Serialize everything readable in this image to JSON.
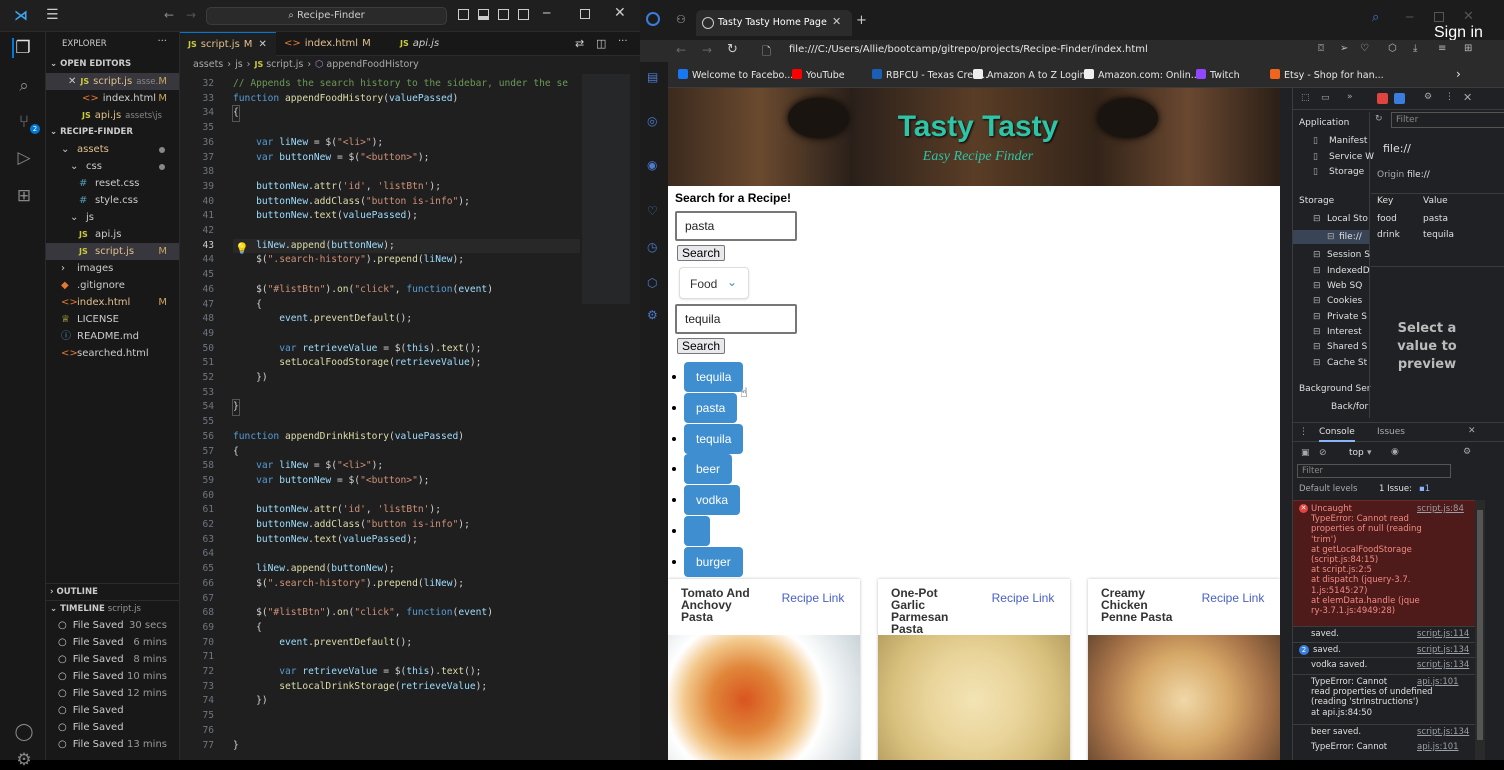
{
  "vscode": {
    "title": "Recipe-Finder",
    "explorer_label": "EXPLORER",
    "open_editors_label": "OPEN EDITORS",
    "open_editors": [
      {
        "name": "script.js",
        "desc": "asse...",
        "mark": "M",
        "type": "js"
      },
      {
        "name": "index.html",
        "desc": "",
        "mark": "M",
        "type": "html"
      },
      {
        "name": "api.js",
        "desc": "assets\\js",
        "mark": "",
        "type": "js"
      }
    ],
    "project_label": "RECIPE-FINDER",
    "tree": [
      {
        "name": "assets",
        "type": "folder",
        "indent": 1
      },
      {
        "name": "css",
        "type": "folder",
        "indent": 2
      },
      {
        "name": "reset.css",
        "type": "css",
        "indent": 3
      },
      {
        "name": "style.css",
        "type": "css",
        "indent": 3
      },
      {
        "name": "js",
        "type": "folder",
        "indent": 2
      },
      {
        "name": "api.js",
        "type": "js",
        "indent": 3
      },
      {
        "name": "script.js",
        "type": "js",
        "indent": 3,
        "mark": "M"
      },
      {
        "name": "images",
        "type": "folder",
        "indent": 1
      },
      {
        "name": ".gitignore",
        "type": "git",
        "indent": 1
      },
      {
        "name": "index.html",
        "type": "html",
        "indent": 1,
        "mark": "M"
      },
      {
        "name": "LICENSE",
        "type": "license",
        "indent": 1
      },
      {
        "name": "README.md",
        "type": "md",
        "indent": 1
      },
      {
        "name": "searched.html",
        "type": "html",
        "indent": 1
      }
    ],
    "outline_label": "OUTLINE",
    "timeline_label": "TIMELINE",
    "timeline_file": "script.js",
    "timeline": [
      {
        "label": "File Saved",
        "time": "30 secs"
      },
      {
        "label": "File Saved",
        "time": "6 mins"
      },
      {
        "label": "File Saved",
        "time": "8 mins"
      },
      {
        "label": "File Saved",
        "time": "10 mins"
      },
      {
        "label": "File Saved",
        "time": "12 mins"
      },
      {
        "label": "File Saved",
        "time": ""
      },
      {
        "label": "File Saved",
        "time": ""
      },
      {
        "label": "File Saved",
        "time": "13 mins"
      }
    ],
    "tabs": [
      {
        "name": "script.js",
        "mark": "M",
        "active": true
      },
      {
        "name": "index.html",
        "mark": "M",
        "active": false
      },
      {
        "name": "api.js",
        "mark": "",
        "active": false
      }
    ],
    "breadcrumb": [
      "assets",
      "js",
      "script.js",
      "appendFoodHistory"
    ],
    "code": [
      {
        "n": "32",
        "t": "// Appends the search history to the sidebar, under the se",
        "k": "cm"
      },
      {
        "n": "33",
        "t": "function appendFoodHistory(valuePassed)",
        "k": "fnline"
      },
      {
        "n": "34",
        "t": "{",
        "k": "brace"
      },
      {
        "n": "35",
        "t": "",
        "k": ""
      },
      {
        "n": "36",
        "t": "    var liNew = $(\"<li>\");",
        "k": ""
      },
      {
        "n": "37",
        "t": "    var buttonNew = $(\"<button>\");",
        "k": ""
      },
      {
        "n": "38",
        "t": "",
        "k": ""
      },
      {
        "n": "39",
        "t": "    buttonNew.attr('id', 'listBtn');",
        "k": ""
      },
      {
        "n": "40",
        "t": "    buttonNew.addClass(\"button is-info\");",
        "k": ""
      },
      {
        "n": "41",
        "t": "    buttonNew.text(valuePassed);",
        "k": ""
      },
      {
        "n": "42",
        "t": "",
        "k": ""
      },
      {
        "n": "43",
        "t": "    liNew.append(buttonNew);",
        "k": ""
      },
      {
        "n": "44",
        "t": "    $(\".search-history\").prepend(liNew);",
        "k": ""
      },
      {
        "n": "45",
        "t": "",
        "k": ""
      },
      {
        "n": "46",
        "t": "    $(\"#listBtn\").on(\"click\", function(event)",
        "k": ""
      },
      {
        "n": "47",
        "t": "    {",
        "k": ""
      },
      {
        "n": "48",
        "t": "        event.preventDefault();",
        "k": ""
      },
      {
        "n": "49",
        "t": "",
        "k": ""
      },
      {
        "n": "50",
        "t": "        var retrieveValue = $(this).text();",
        "k": ""
      },
      {
        "n": "51",
        "t": "        setLocalFoodStorage(retrieveValue);",
        "k": ""
      },
      {
        "n": "52",
        "t": "    })",
        "k": ""
      },
      {
        "n": "53",
        "t": "",
        "k": ""
      },
      {
        "n": "54",
        "t": "}",
        "k": "brace"
      },
      {
        "n": "55",
        "t": "",
        "k": ""
      },
      {
        "n": "56",
        "t": "function appendDrinkHistory(valuePassed)",
        "k": "fnline"
      },
      {
        "n": "57",
        "t": "{",
        "k": ""
      },
      {
        "n": "58",
        "t": "    var liNew = $(\"<li>\");",
        "k": ""
      },
      {
        "n": "59",
        "t": "    var buttonNew = $(\"<button>\");",
        "k": ""
      },
      {
        "n": "60",
        "t": "",
        "k": ""
      },
      {
        "n": "61",
        "t": "    buttonNew.attr('id', 'listBtn');",
        "k": ""
      },
      {
        "n": "62",
        "t": "    buttonNew.addClass(\"button is-info\");",
        "k": ""
      },
      {
        "n": "63",
        "t": "    buttonNew.text(valuePassed);",
        "k": ""
      },
      {
        "n": "64",
        "t": "",
        "k": ""
      },
      {
        "n": "65",
        "t": "    liNew.append(buttonNew);",
        "k": ""
      },
      {
        "n": "66",
        "t": "    $(\".search-history\").prepend(liNew);",
        "k": ""
      },
      {
        "n": "67",
        "t": "",
        "k": ""
      },
      {
        "n": "68",
        "t": "    $(\"#listBtn\").on(\"click\", function(event)",
        "k": ""
      },
      {
        "n": "69",
        "t": "    {",
        "k": ""
      },
      {
        "n": "70",
        "t": "        event.preventDefault();",
        "k": ""
      },
      {
        "n": "71",
        "t": "",
        "k": ""
      },
      {
        "n": "72",
        "t": "        var retrieveValue = $(this).text();",
        "k": ""
      },
      {
        "n": "73",
        "t": "        setLocalDrinkStorage(retrieveValue);",
        "k": ""
      },
      {
        "n": "74",
        "t": "    })",
        "k": ""
      },
      {
        "n": "75",
        "t": "",
        "k": ""
      },
      {
        "n": "76",
        "t": "",
        "k": ""
      },
      {
        "n": "77",
        "t": "}",
        "k": ""
      }
    ],
    "current_line": "43"
  },
  "browser": {
    "tab_title": "Tasty Tasty Home Page",
    "url": "file:///C:/Users/Allie/bootcamp/gitrepo/projects/Recipe-Finder/index.html",
    "sign_in": "Sign in",
    "bookmarks": [
      {
        "label": "Welcome to Facebo...",
        "color": "#1877f2"
      },
      {
        "label": "YouTube",
        "color": "#ff0000"
      },
      {
        "label": "RBFCU - Texas Cred...",
        "color": "#1a5fb4"
      },
      {
        "label": "Amazon A to Z Login",
        "color": "#eeeeee"
      },
      {
        "label": "Amazon.com: Onlin...",
        "color": "#eeeeee"
      },
      {
        "label": "Twitch",
        "color": "#9146ff"
      },
      {
        "label": "Etsy - Shop for han...",
        "color": "#f1641e"
      }
    ]
  },
  "page": {
    "title": "Tasty Tasty",
    "subtitle": "Easy Recipe Finder",
    "search_heading": "Search for a Recipe!",
    "food_input": "pasta",
    "search_btn": "Search",
    "category_select": "Food",
    "drink_input": "tequila",
    "search_btn2": "Search",
    "history": [
      "tequila",
      "pasta",
      "tequila",
      "beer",
      "vodka",
      "",
      "burger"
    ],
    "cards": [
      {
        "title": "Tomato And Anchovy Pasta",
        "link": "Recipe Link"
      },
      {
        "title": "One-Pot Garlic Parmesan Pasta",
        "link": "Recipe Link"
      },
      {
        "title": "Creamy Chicken Penne Pasta",
        "link": "Recipe Link"
      }
    ],
    "colors": {
      "title": "#2ec4a7",
      "button": "#3e8ed0",
      "link": "#485fc7"
    }
  },
  "devtools": {
    "application_label": "Application",
    "filter_placeholder": "Filter",
    "app_items": [
      "Manifest",
      "Service W",
      "Storage"
    ],
    "storage_label": "Storage",
    "storage_items": [
      "Local Sto",
      "file://",
      "Session S",
      "IndexedD",
      "Web SQ",
      "Cookies",
      "Private S",
      "Interest",
      "Shared S",
      "Cache St"
    ],
    "bg_label": "Background Ser",
    "bg_item": "Back/for",
    "origin_file": "file://",
    "origin_label": "Origin",
    "origin_value": "file://",
    "kv_headers": [
      "Key",
      "Value"
    ],
    "kv": [
      {
        "key": "food",
        "value": "pasta"
      },
      {
        "key": "drink",
        "value": "tequila"
      }
    ],
    "preview_text": "Select a value to preview",
    "console_tab": "Console",
    "issues_tab": "Issues",
    "context": "top",
    "console_filter": "Filter",
    "levels": "Default levels",
    "issues_count": "1 Issue:",
    "issues_badge": "1",
    "error_lines": [
      "Uncaught",
      "TypeError: Cannot read",
      "properties of null (reading",
      "'trim')",
      "    at getLocalFoodStorage",
      "(script.js:84:15)",
      "    at script.js:2:5",
      "    at dispatch (jquery-3.7.",
      "1.js:5145:27)",
      "    at elemData.handle (jque",
      "ry-3.7.1.js:4949:28)"
    ],
    "error_src": "script.js:84",
    "logs": [
      {
        "text": "saved.",
        "src": "script.js:114",
        "badge": ""
      },
      {
        "text": "saved.",
        "src": "script.js:134",
        "badge": "2"
      },
      {
        "text": "vodka saved.",
        "src": "script.js:134",
        "badge": ""
      }
    ],
    "type_error2": [
      "TypeError: Cannot",
      "read properties of undefined",
      "(reading 'strInstructions')",
      "    at api.js:84:50"
    ],
    "type_error2_src": "api.js:101",
    "beer_log": "beer saved.",
    "beer_src": "script.js:134",
    "type_error3": "TypeError: Cannot",
    "type_error3_src": "api.js:101"
  }
}
